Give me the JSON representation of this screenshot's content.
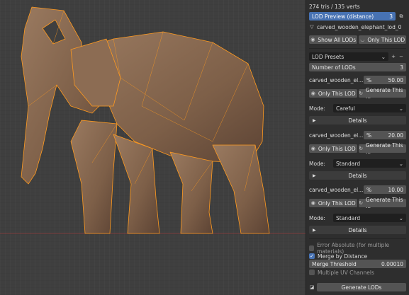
{
  "viewport": {
    "stats": "274 tris / 135 verts"
  },
  "panel": {
    "lod_preview": {
      "label": "LOD Preview (distance)",
      "value": "3"
    },
    "object_name": "carved_wooden_elephant_lod_0",
    "show_all_lods": "Show All LODs",
    "only_this_lod_top": "Only This LOD",
    "lod_presets": "LOD Presets",
    "number_of_lods": {
      "label": "Number of LODs",
      "value": "3"
    },
    "lods": [
      {
        "name": "carved_wooden_el...",
        "unit": "%",
        "value": "50.00",
        "only_label": "Only This LOD",
        "generate_label": "Generate This ...",
        "mode_label": "Mode:",
        "mode_value": "Careful",
        "details": "Details"
      },
      {
        "name": "carved_wooden_el...",
        "unit": "%",
        "value": "20.00",
        "only_label": "Only This LOD",
        "generate_label": "Generate This ...",
        "mode_label": "Mode:",
        "mode_value": "Standard",
        "details": "Details"
      },
      {
        "name": "carved_wooden_el...",
        "unit": "%",
        "value": "10.00",
        "only_label": "Only This LOD",
        "generate_label": "Generate This ...",
        "mode_label": "Mode:",
        "mode_value": "Standard",
        "details": "Details"
      }
    ],
    "error_absolute": "Error Absolute (for multiple materials)",
    "merge_by_distance": "Merge by Distance",
    "merge_threshold": {
      "label": "Merge Threshold",
      "value": "0.00010"
    },
    "multiple_uv": "Multiple UV Channels",
    "generate_lods": "Generate LODs"
  },
  "colors": {
    "accent": "#4772b3",
    "wire": "#ff9a1f",
    "mesh": "#8a6a52"
  }
}
